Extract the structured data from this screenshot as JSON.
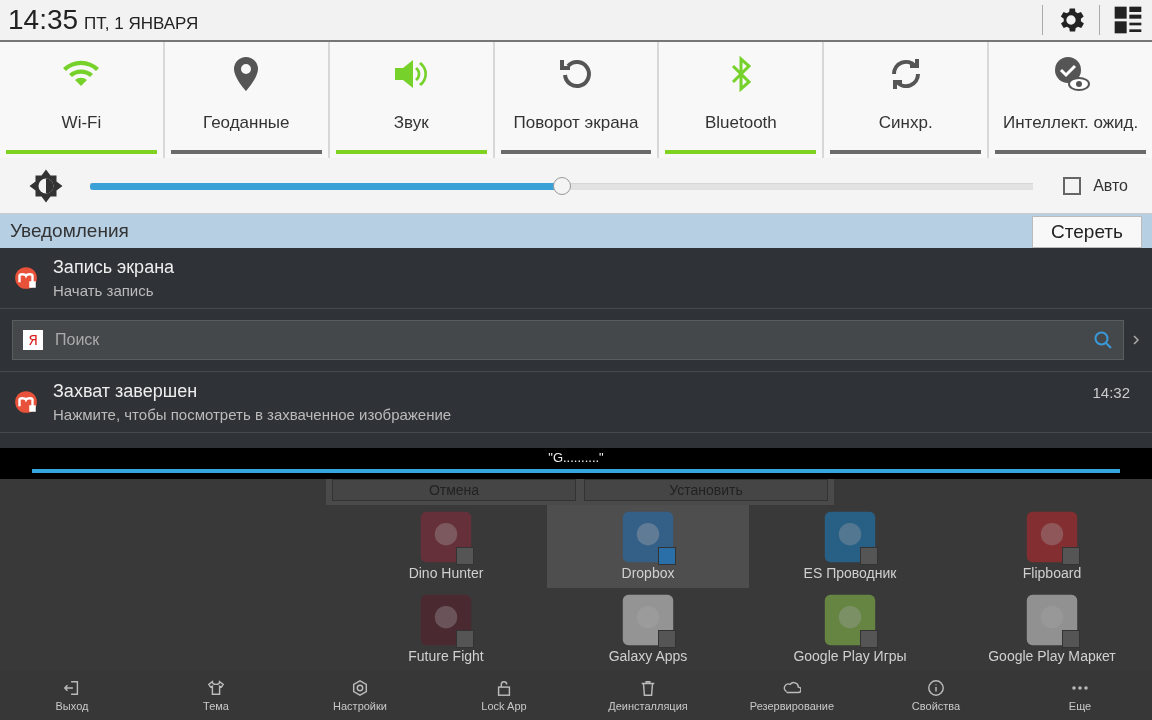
{
  "status_bar": {
    "time": "14:35",
    "date": "ПТ, 1 ЯНВАРЯ"
  },
  "quick_settings": [
    {
      "kind": "wifi",
      "label": "Wi-Fi",
      "on": true
    },
    {
      "kind": "location",
      "label": "Геоданные",
      "on": false
    },
    {
      "kind": "sound",
      "label": "Звук",
      "on": true
    },
    {
      "kind": "rotate",
      "label": "Поворот экрана",
      "on": false
    },
    {
      "kind": "bluetooth",
      "label": "Bluetooth",
      "on": true
    },
    {
      "kind": "sync",
      "label": "Синхр.",
      "on": false
    },
    {
      "kind": "smart",
      "label": "Интеллект. ожид.",
      "on": false
    }
  ],
  "brightness": {
    "level": 0.5,
    "auto": {
      "label": "Авто",
      "checked": false
    }
  },
  "notifications": {
    "title": "Уведомления",
    "clear_button": "Стереть",
    "items": [
      {
        "kind": "notification",
        "title": "Запись экрана",
        "text": "Начать запись"
      },
      {
        "kind": "search",
        "placeholder": "Поиск",
        "logo": "Я"
      },
      {
        "kind": "notification",
        "title": "Захват завершен",
        "text": "Нажмите, чтобы посмотреть в захваченное изображение",
        "time": "14:32"
      }
    ]
  },
  "toast": {
    "text": "\"G..........\"",
    "level": 1
  },
  "background_app": {
    "dialog_buttons": [
      "Отмена",
      "Установить"
    ],
    "apps": [
      {
        "label": "Dino Hunter",
        "checked": false,
        "selected": false
      },
      {
        "label": "Dropbox",
        "checked": true,
        "selected": true
      },
      {
        "label": "ES Проводник",
        "checked": false,
        "selected": false
      },
      {
        "label": "Flipboard",
        "checked": false,
        "selected": false
      },
      {
        "label": "Future Fight",
        "checked": false,
        "selected": false
      },
      {
        "label": "Galaxy Apps",
        "checked": false,
        "selected": false
      },
      {
        "label": "Google Play Игры",
        "checked": false,
        "selected": false
      },
      {
        "label": "Google Play Маркет",
        "checked": false,
        "selected": false
      }
    ],
    "toolbar": [
      {
        "kind": "exit",
        "label": "Выход"
      },
      {
        "kind": "theme",
        "label": "Тема"
      },
      {
        "kind": "settings",
        "label": "Настройки"
      },
      {
        "kind": "lock",
        "label": "Lock App"
      },
      {
        "kind": "trash",
        "label": "Деинсталляция"
      },
      {
        "kind": "backup",
        "label": "Резервирование"
      },
      {
        "kind": "info",
        "label": "Свойства"
      },
      {
        "kind": "more",
        "label": "Еще"
      }
    ]
  }
}
